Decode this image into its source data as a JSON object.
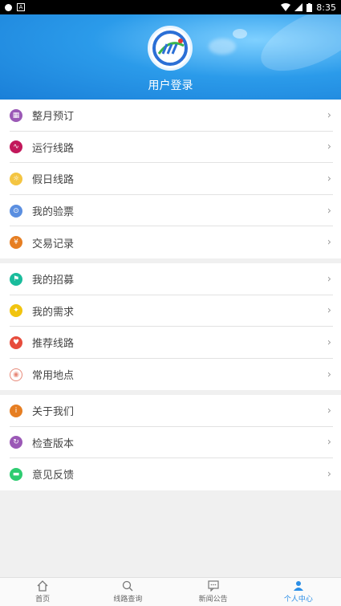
{
  "status_bar": {
    "time": "8:35"
  },
  "header": {
    "login_label": "用户登录"
  },
  "groups": [
    [
      {
        "label": "整月预订",
        "icon": "calendar-icon",
        "color": "#9b59b6"
      },
      {
        "label": "运行线路",
        "icon": "route-icon",
        "color": "#c2185b"
      },
      {
        "label": "假日线路",
        "icon": "holiday-icon",
        "color": "#f4c542"
      },
      {
        "label": "我的验票",
        "icon": "ticket-icon",
        "color": "#5b8fe0"
      },
      {
        "label": "交易记录",
        "icon": "yen-icon",
        "color": "#e67e22"
      }
    ],
    [
      {
        "label": "我的招募",
        "icon": "flag-icon",
        "color": "#1abc9c"
      },
      {
        "label": "我的需求",
        "icon": "bulb-icon",
        "color": "#f1c40f"
      },
      {
        "label": "推荐线路",
        "icon": "heart-icon",
        "color": "#e74c3c"
      },
      {
        "label": "常用地点",
        "icon": "location-icon",
        "color": "#e88a7a"
      }
    ],
    [
      {
        "label": "关于我们",
        "icon": "info-icon",
        "color": "#e67e22"
      },
      {
        "label": "检查版本",
        "icon": "refresh-icon",
        "color": "#9b59b6"
      },
      {
        "label": "意见反馈",
        "icon": "chat-icon",
        "color": "#2ecc71"
      }
    ]
  ],
  "tabs": [
    {
      "label": "首页",
      "icon": "home-icon"
    },
    {
      "label": "线路查询",
      "icon": "search-icon"
    },
    {
      "label": "新闻公告",
      "icon": "news-icon"
    },
    {
      "label": "个人中心",
      "icon": "user-icon"
    }
  ],
  "colors": {
    "accent": "#2a8ee6"
  }
}
